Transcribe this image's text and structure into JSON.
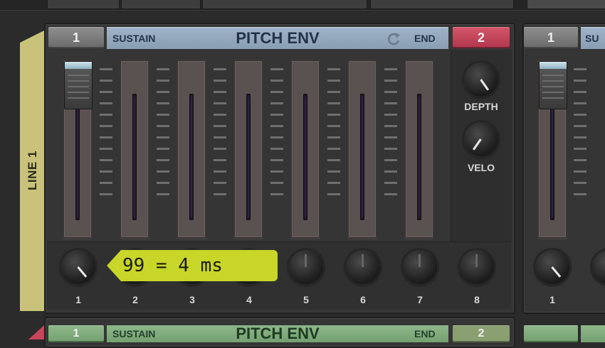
{
  "side_label": "LINE 1",
  "header": {
    "start_step": "1",
    "sustain_label": "SUSTAIN",
    "title": "PITCH ENV",
    "end_label": "END",
    "end_step": "2",
    "loop_icon": "loop-arrow-icon"
  },
  "faders": {
    "count": 7,
    "active_level": 1.0
  },
  "depth_label": "DEPTH",
  "velo_label": "VELO",
  "knob_numbers": [
    "1",
    "2",
    "3",
    "4",
    "5",
    "6",
    "7",
    "8"
  ],
  "tooltip": "99 = 4 ms",
  "right_panel": {
    "start_step": "1",
    "sustain_label_partial": "SU",
    "knob_number": "1"
  },
  "bottom_panel": {
    "step1": "1",
    "sustain_label": "SUSTAIN",
    "title": "PITCH ENV",
    "end_label": "END",
    "step2": "2"
  },
  "colors": {
    "header_blue": "#9fb2c7",
    "side_label_yellow": "#c8c27a",
    "end_red": "#c8455c",
    "tooltip_lime": "#c8d62a",
    "bottom_green": "#8eb88a"
  }
}
